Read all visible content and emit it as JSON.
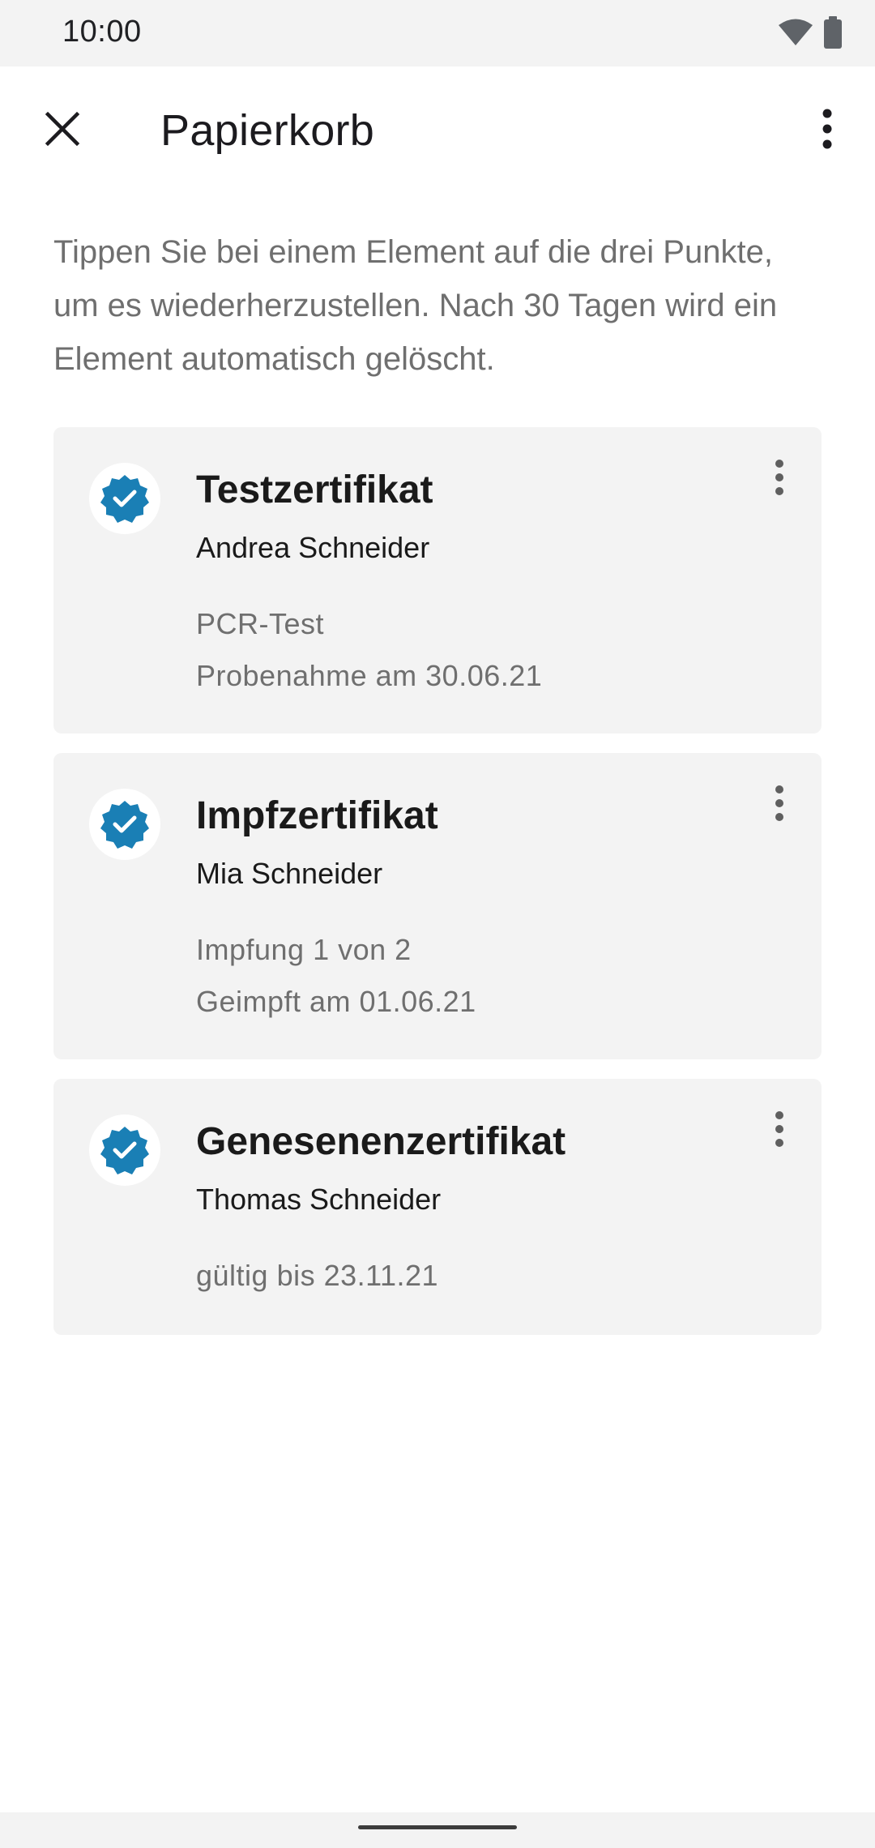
{
  "status_bar": {
    "time": "10:00",
    "icons": [
      "wifi-icon",
      "battery-icon"
    ]
  },
  "app_bar": {
    "title": "Papierkorb",
    "close_icon": "close-icon",
    "menu_icon": "more-vert-icon"
  },
  "intro": {
    "text": "Tippen Sie bei einem Element auf die drei Punkte, um es wiederherzustellen. Nach 30 Tagen wird ein Element automatisch gelöscht."
  },
  "certificates": [
    {
      "title": "Testzertifikat",
      "name": "Andrea Schneider",
      "line1": "PCR-Test",
      "line2": "Probenahme am 30.06.21",
      "icon": "verified-badge-icon"
    },
    {
      "title": "Impfzertifikat",
      "name": "Mia Schneider",
      "line1": "Impfung 1 von 2",
      "line2": "Geimpft am 01.06.21",
      "icon": "verified-badge-icon"
    },
    {
      "title": "Genesenenzertifikat",
      "name": "Thomas Schneider",
      "line1": "gültig bis 23.11.21",
      "icon": "verified-badge-icon"
    }
  ],
  "colors": {
    "accent": "#1a7fb5",
    "card_background": "#f3f3f3",
    "secondary_text": "#6f6f6f"
  }
}
